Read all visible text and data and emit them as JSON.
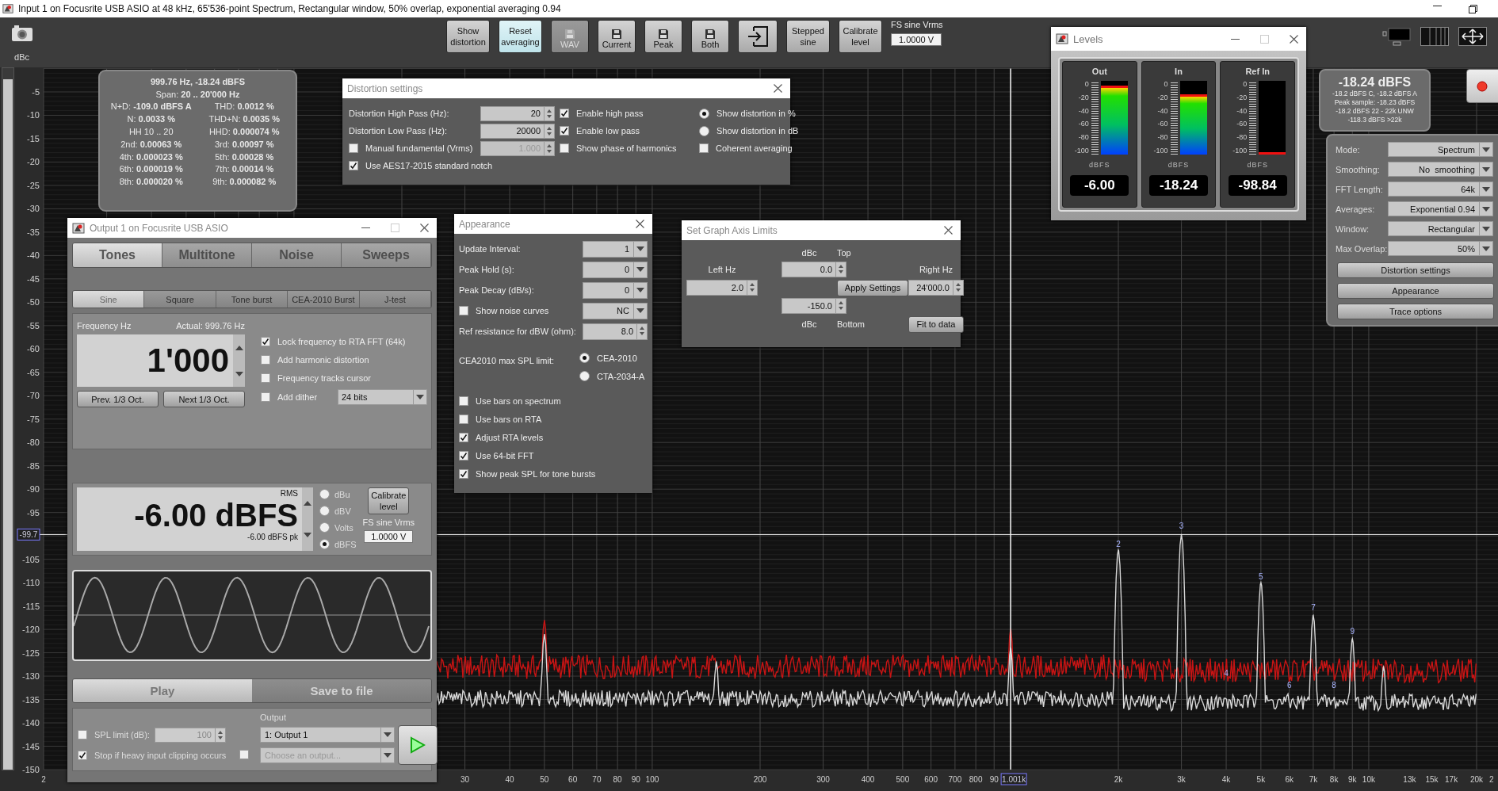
{
  "window": {
    "title": "Input 1 on Focusrite USB ASIO at 48 kHz, 65'536-point Spectrum, Rectangular window, 50% overlap, exponential averaging 0.94"
  },
  "toolbar": {
    "buttons": [
      {
        "kind": "text",
        "label": "Show distortion",
        "highlighted": false,
        "disabled": false
      },
      {
        "kind": "text",
        "label": "Reset averaging",
        "highlighted": true,
        "disabled": false
      },
      {
        "kind": "save",
        "label": "WAV",
        "highlighted": false,
        "disabled": true
      },
      {
        "kind": "save",
        "label": "Current",
        "highlighted": false,
        "disabled": false
      },
      {
        "kind": "save",
        "label": "Peak",
        "highlighted": false,
        "disabled": false
      },
      {
        "kind": "save",
        "label": "Both",
        "highlighted": false,
        "disabled": false
      },
      {
        "kind": "export",
        "highlighted": false,
        "disabled": false
      },
      {
        "kind": "text",
        "label": "Stepped sine",
        "highlighted": false,
        "disabled": false
      },
      {
        "kind": "text",
        "label": "Calibrate level",
        "highlighted": false,
        "disabled": false
      }
    ],
    "fs_label": "FS sine Vrms",
    "fs_value": "1.0000 V"
  },
  "plot": {
    "y_unit": "dBc",
    "y_axis_labels": [
      "-5",
      "-10",
      "-15",
      "-20",
      "-25",
      "-30",
      "-35",
      "-40",
      "-45",
      "-50",
      "-55",
      "-60",
      "-65",
      "-70",
      "-75",
      "-80",
      "-85",
      "-90",
      "-95",
      "-105",
      "-110",
      "-115",
      "-120",
      "-125",
      "-130",
      "-135",
      "-140",
      "-145",
      "-150"
    ],
    "x_axis_labels": [
      "2",
      "30",
      "40",
      "50",
      "60",
      "70",
      "80",
      "90",
      "100",
      "200",
      "300",
      "400",
      "500",
      "600",
      "700",
      "800",
      "90",
      "2k",
      "3k",
      "4k",
      "5k",
      "6k",
      "7k",
      "8k",
      "9k",
      "10k",
      "13k",
      "15k",
      "17k",
      "20k",
      "2"
    ],
    "cursor": {
      "x_label": "1.001k",
      "y_label": "-99.7"
    },
    "harmonic_labels": [
      "2",
      "3",
      "4",
      "5",
      "6",
      "7",
      "8",
      "9"
    ],
    "stats": {
      "heading": "999.76 Hz, -18.24 dBFS",
      "span": "Span: **20 .. 20'000 Hz**",
      "cells": [
        "N+D: **-109.0 dBFS A**",
        "THD: **0.0012 %**",
        "N: **0.0033 %**",
        "THD+N: **0.0035 %**",
        "HH 10 .. 20",
        "HHD: **0.000074 %**",
        "2nd: **0.00063 %**",
        "3rd: **0.00097 %**",
        "4th: **0.000023 %**",
        "5th: **0.00028 %**",
        "6th: **0.000019 %**",
        "7th: **0.00014 %**",
        "8th: **0.000020 %**",
        "9th: **0.000082 %**"
      ]
    }
  },
  "distortion_settings": {
    "title": "Distortion settings",
    "fields": [
      {
        "label": "Distortion High Pass (Hz):",
        "value": "20",
        "disabled": false
      },
      {
        "label": "Distortion Low Pass (Hz):",
        "value": "20000",
        "disabled": false
      },
      {
        "label": "Manual fundamental (Vrms)",
        "value": "1.000",
        "disabled": true,
        "checked": false
      }
    ],
    "aes": {
      "label": "Use AES17-2015 standard notch",
      "checked": true
    },
    "checks": [
      {
        "label": "Enable high pass",
        "checked": true
      },
      {
        "label": "Enable low pass",
        "checked": true
      },
      {
        "label": "Show phase of harmonics",
        "checked": false
      }
    ],
    "radios": [
      {
        "label": "Show distortion in %",
        "selected": true
      },
      {
        "label": "Show distortion in dB",
        "selected": false
      }
    ],
    "coherent": {
      "label": "Coherent averaging",
      "checked": false
    }
  },
  "generator": {
    "title": "Output 1 on Focusrite USB ASIO",
    "tabs": [
      {
        "label": "Tones",
        "selected": true
      },
      {
        "label": "Multitone",
        "selected": false
      },
      {
        "label": "Noise",
        "selected": false
      },
      {
        "label": "Sweeps",
        "selected": false
      }
    ],
    "subtabs": [
      {
        "label": "Sine",
        "selected": true
      },
      {
        "label": "Square",
        "selected": false
      },
      {
        "label": "Tone burst",
        "selected": false
      },
      {
        "label": "CEA-2010 Burst",
        "selected": false
      },
      {
        "label": "J-test",
        "selected": false
      }
    ],
    "frequency": {
      "label": "Frequency Hz",
      "actual": "Actual: 999.76 Hz",
      "value": "1'000",
      "buttons": [
        "Prev. 1/3 Oct.",
        "Next 1/3 Oct."
      ]
    },
    "options": [
      {
        "label": "Lock frequency to RTA FFT (64k)",
        "checked": true
      },
      {
        "label": "Add harmonic distortion",
        "checked": false
      },
      {
        "label": "Frequency tracks cursor",
        "checked": false
      },
      {
        "label": "Add dither",
        "checked": false
      }
    ],
    "dither": "24 bits",
    "level": {
      "mode": "RMS",
      "value": "-6.00 dBFS",
      "peak": "-6.00 dBFS pk",
      "units": [
        {
          "label": "dBu",
          "selected": false
        },
        {
          "label": "dBV",
          "selected": false
        },
        {
          "label": "Volts",
          "selected": false
        },
        {
          "label": "dBFS",
          "selected": true
        }
      ],
      "calibrate": "Calibrate level",
      "fs_label": "FS sine Vrms",
      "fs_value": "1.0000 V"
    },
    "actions": [
      {
        "label": "Play",
        "selected": true
      },
      {
        "label": "Save to file",
        "selected": false
      }
    ],
    "spl": {
      "label": "SPL limit (dB):",
      "checked": false,
      "value": "100"
    },
    "clip": {
      "label": "Stop if heavy input clipping occurs",
      "checked": true
    },
    "output": {
      "label": "Output",
      "value": "1: Output 1"
    },
    "output2": {
      "checked": false,
      "placeholder": "Choose an output..."
    }
  },
  "appearance": {
    "title": "Appearance",
    "rows": [
      {
        "kind": "dropdown",
        "label": "Update Interval:",
        "value": "1"
      },
      {
        "kind": "dropdown",
        "label": "Peak Hold (s):",
        "value": "0"
      },
      {
        "kind": "dropdown",
        "label": "Peak Decay (dB/s):",
        "value": "0"
      },
      {
        "kind": "check_dropdown",
        "label": "Show noise curves",
        "value": "NC",
        "checked": false
      },
      {
        "kind": "spin",
        "label": "Ref resistance for dBW (ohm):",
        "value": "8.0"
      }
    ],
    "spl_label": "CEA2010 max SPL limit:",
    "spl_options": [
      {
        "label": "CEA-2010",
        "selected": true
      },
      {
        "label": "CTA-2034-A",
        "selected": false
      }
    ],
    "checks": [
      {
        "label": "Use bars on spectrum",
        "checked": false
      },
      {
        "label": "Use bars on RTA",
        "checked": false
      },
      {
        "label": "Adjust RTA levels",
        "checked": true
      },
      {
        "label": "Use 64-bit FFT",
        "checked": true
      },
      {
        "label": "Show peak SPL for tone bursts",
        "checked": true
      }
    ]
  },
  "axis_limits": {
    "title": "Set Graph Axis Limits",
    "top_unit": "dBc",
    "top_label": "Top",
    "top_value": "0.0",
    "left_label": "Left Hz",
    "left_value": "2.0",
    "apply": "Apply Settings",
    "right_label": "Right Hz",
    "right_value": "24'000.0",
    "bottom_value": "-150.0",
    "bottom_unit": "dBc",
    "bottom_label": "Bottom",
    "fit": "Fit to data"
  },
  "levels": {
    "title": "Levels",
    "meters": [
      {
        "name": "Out",
        "level": 0.94,
        "scale": [
          "0",
          "-20",
          "-40",
          "-60",
          "-80",
          "-100"
        ],
        "unit": "dBFS",
        "reading": "-6.00"
      },
      {
        "name": "In",
        "level": 0.82,
        "scale": [
          "0",
          "-20",
          "-40",
          "-60",
          "-80",
          "-100"
        ],
        "unit": "dBFS",
        "reading": "-18.24"
      },
      {
        "name": "Ref In",
        "level": 0.03,
        "scale": [
          "0",
          "-20",
          "-40",
          "-60",
          "-80",
          "-100"
        ],
        "unit": "dBFS",
        "reading": "-98.84"
      }
    ]
  },
  "readout": {
    "value": "-18.24 dBFS",
    "lines": [
      "-18.2 dBFS C, -18.2 dBFS A",
      "Peak sample: -18.23 dBFS",
      "-18.2 dBFS 22 - 22k UNW",
      "-118.3 dBFS >22k"
    ]
  },
  "analyzer": {
    "settings": [
      {
        "label": "Mode:",
        "value": "Spectrum"
      },
      {
        "label": "Smoothing:",
        "value": "No  smoothing"
      },
      {
        "label": "FFT Length:",
        "value": "64k"
      },
      {
        "label": "Averages:",
        "value": "Exponential 0.94"
      },
      {
        "label": "Window:",
        "value": "Rectangular"
      },
      {
        "label": "Max Overlap:",
        "value": "50%"
      }
    ],
    "buttons": [
      "Distortion settings",
      "Appearance",
      "Trace options"
    ]
  }
}
